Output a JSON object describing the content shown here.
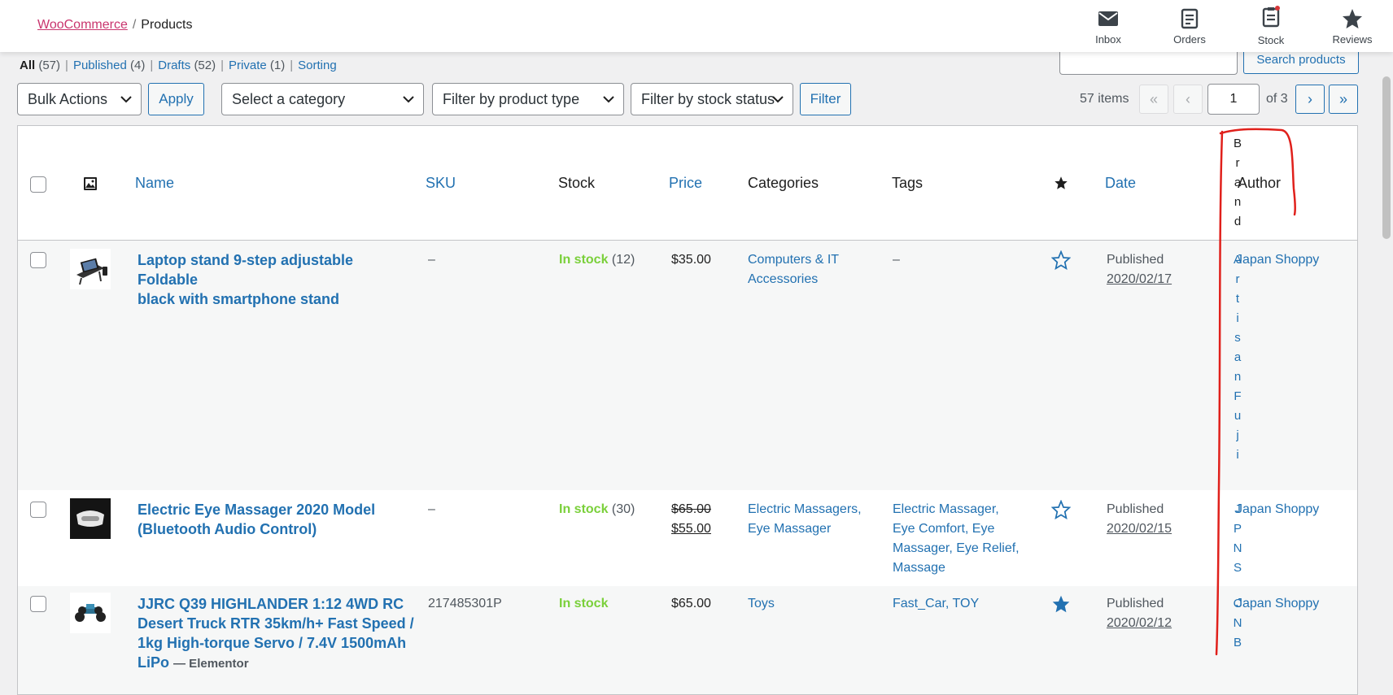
{
  "header": {
    "breadcrumb_root": "WooCommerce",
    "breadcrumb_sep": "/",
    "breadcrumb_current": "Products",
    "actions": [
      {
        "label": "Inbox",
        "icon": "envelope-icon"
      },
      {
        "label": "Orders",
        "icon": "clipboard-icon"
      },
      {
        "label": "Stock",
        "icon": "stock-clipboard-icon"
      },
      {
        "label": "Reviews",
        "icon": "star-icon"
      }
    ]
  },
  "status_filters": [
    {
      "label": "All",
      "count": "(57)"
    },
    {
      "label": "Published",
      "count": "(4)"
    },
    {
      "label": "Drafts",
      "count": "(52)"
    },
    {
      "label": "Private",
      "count": "(1)"
    },
    {
      "label": "Sorting",
      "count": ""
    }
  ],
  "search": {
    "button_label": "Search products",
    "value": ""
  },
  "tablenav": {
    "bulk_actions": "Bulk Actions",
    "apply_label": "Apply",
    "category_filter": "Select a category",
    "type_filter": "Filter by product type",
    "stock_filter": "Filter by stock status",
    "filter_label": "Filter",
    "items_count": "57 items",
    "first": "«",
    "prev": "‹",
    "current_page": "1",
    "of_total": "of 3",
    "next": "›",
    "last": "»"
  },
  "columns": {
    "name": "Name",
    "sku": "SKU",
    "stock": "Stock",
    "price": "Price",
    "categories": "Categories",
    "tags": "Tags",
    "date": "Date",
    "brand_letters": [
      "B",
      "r",
      "a",
      "n",
      "d"
    ],
    "author": "Author"
  },
  "rows": [
    {
      "name_lines": [
        "Laptop stand 9-step adjustable Foldable",
        "black with smartphone stand"
      ],
      "name_suffix": "",
      "sku": "–",
      "stock_status": "In stock",
      "stock_qty": "(12)",
      "price_regular": "$35.00",
      "price_sale": "",
      "categories_lines": [
        "Computers & IT",
        "Accessories"
      ],
      "tags_lines": [
        "–"
      ],
      "featured": false,
      "date_status": "Published",
      "date_value": "2020/02/17",
      "brand_letters": [
        "A",
        "r",
        "t",
        "i",
        "s",
        "a",
        "n",
        "F",
        "u",
        "j",
        "i"
      ],
      "author": "Japan Shoppy"
    },
    {
      "name_lines": [
        "Electric Eye Massager 2020 Model",
        "(Bluetooth Audio Control)"
      ],
      "name_suffix": "",
      "sku": "–",
      "stock_status": "In stock",
      "stock_qty": "(30)",
      "price_regular": "$65.00",
      "price_sale": "$55.00",
      "categories_lines": [
        "Electric Massagers,",
        "Eye Massager"
      ],
      "tags_lines": [
        "Electric Massager,",
        "Eye Comfort, Eye",
        "Massager, Eye Relief,",
        "Massage"
      ],
      "featured": false,
      "date_status": "Published",
      "date_value": "2020/02/15",
      "brand_letters": [
        "J",
        "P",
        "N",
        "S"
      ],
      "author": "Japan Shoppy"
    },
    {
      "name_lines": [
        "JJRC Q39 HIGHLANDER 1:12 4WD RC",
        "Desert Truck RTR 35km/h+ Fast Speed /",
        "1kg High-torque Servo / 7.4V 1500mAh",
        "LiPo"
      ],
      "name_suffix": "— Elementor",
      "sku": "217485301P",
      "stock_status": "In stock",
      "stock_qty": "",
      "price_regular": "$65.00",
      "price_sale": "",
      "categories_lines": [
        "Toys"
      ],
      "tags_lines": [
        "Fast_Car, TOY"
      ],
      "featured": true,
      "date_status": "Published",
      "date_value": "2020/02/12",
      "brand_letters": [
        "C",
        "N",
        "B"
      ],
      "author": "Japan Shoppy"
    }
  ],
  "colors": {
    "link": "#2271b1",
    "instock": "#7ad03a",
    "woo_pink": "#c9356e",
    "annotation": "#e0201b"
  }
}
